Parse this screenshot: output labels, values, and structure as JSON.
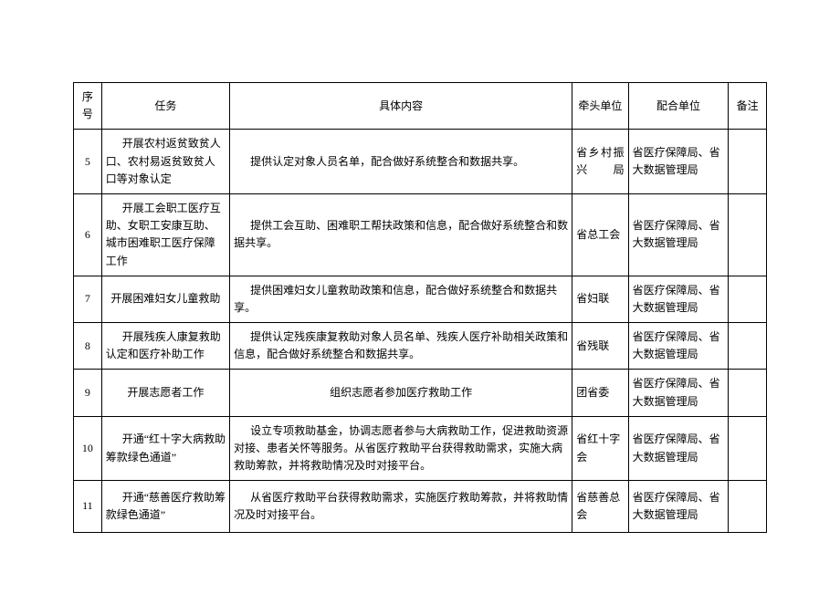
{
  "table": {
    "headers": {
      "seq": "序号",
      "task": "任务",
      "content": "具体内容",
      "lead": "牵头单位",
      "coop": "配合单位",
      "remark": "备注"
    },
    "rows": [
      {
        "seq": "5",
        "task": "开展农村返贫致贫人口、农村易返贫致贫人口等对象认定",
        "content": "提供认定对象人员名单，配合做好系统整合和数据共享。",
        "lead": "省乡村振兴局",
        "coop": "省医疗保障局、省大数据管理局",
        "remark": ""
      },
      {
        "seq": "6",
        "task": "开展工会职工医疗互助、女职工安康互助、城市困难职工医疗保障工作",
        "content": "提供工会互助、困难职工帮扶政策和信息，配合做好系统整合和数据共享。",
        "lead": "省总工会",
        "coop": "省医疗保障局、省大数据管理局",
        "remark": ""
      },
      {
        "seq": "7",
        "task": "开展困难妇女儿童救助",
        "content": "提供困难妇女儿童救助政策和信息，配合做好系统整合和数据共享。",
        "lead": "省妇联",
        "coop": "省医疗保障局、省大数据管理局",
        "remark": ""
      },
      {
        "seq": "8",
        "task": "开展残疾人康复救助认定和医疗补助工作",
        "content": "提供认定残疾康复救助对象人员名单、残疾人医疗补助相关政策和信息，配合做好系统整合和数据共享。",
        "lead": "省残联",
        "coop": "省医疗保障局、省大数据管理局",
        "remark": ""
      },
      {
        "seq": "9",
        "task": "开展志愿者工作",
        "content": "组织志愿者参加医疗救助工作",
        "lead": "团省委",
        "coop": "省医疗保障局、省大数据管理局",
        "remark": ""
      },
      {
        "seq": "10",
        "task": "开通“红十字大病救助筹款绿色通道”",
        "content": "设立专项救助基金，协调志愿者参与大病救助工作，促进救助资源对接、患者关怀等服务。从省医疗救助平台获得救助需求，实施大病救助筹款，并将救助情况及时对接平台。",
        "lead": "省红十字会",
        "coop": "省医疗保障局、省大数据管理局",
        "remark": ""
      },
      {
        "seq": "11",
        "task": "开通“慈善医疗救助筹款绿色通道”",
        "content": "从省医疗救助平台获得救助需求，实施医疗救助筹款，并将救助情况及时对接平台。",
        "lead": "省慈善总会",
        "coop": "省医疗保障局、省大数据管理局",
        "remark": ""
      }
    ]
  }
}
